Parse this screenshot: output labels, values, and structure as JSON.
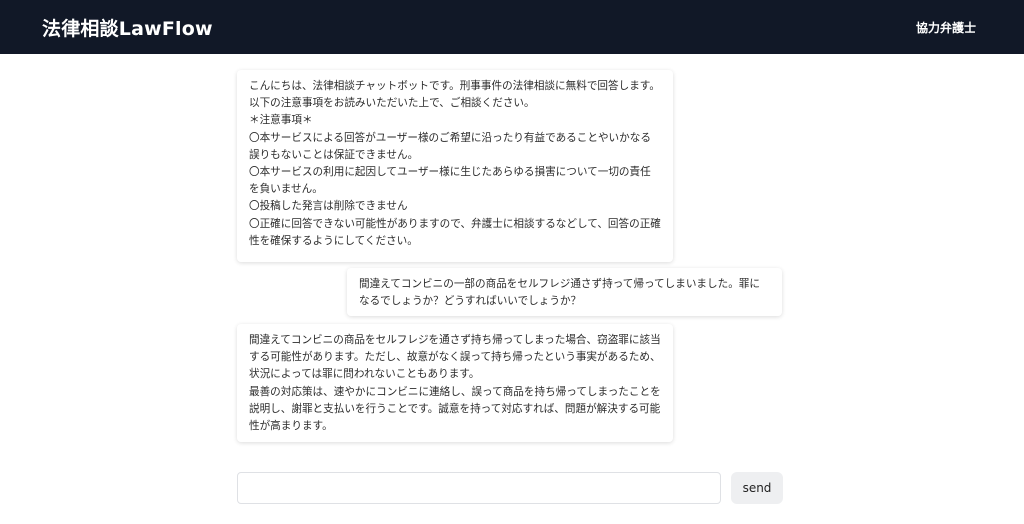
{
  "header": {
    "brand": "法律相談LawFlow",
    "partner_link": "協力弁護士"
  },
  "messages": [
    {
      "role": "bot",
      "text": "こんにちは、法律相談チャットボットです。刑事事件の法律相談に無料で回答します。以下の注意事項をお読みいただいた上で、ご相談ください。\n＊注意事項＊\n〇本サービスによる回答がユーザー様のご希望に沿ったり有益であることやいかなる誤りもないことは保証できません。\n〇本サービスの利用に起因してユーザー様に生じたあらゆる損害について一切の責任を負いません。\n〇投稿した発言は削除できません\n〇正確に回答できない可能性がありますので、弁護士に相談するなどして、回答の正確性を確保するようにしてください。"
    },
    {
      "role": "user",
      "text": "間違えてコンビニの一部の商品をセルフレジ通さず持って帰ってしまいました。罪になるでしょうか？どうすればいいでしょうか？"
    },
    {
      "role": "bot",
      "text": "間違えてコンビニの商品をセルフレジを通さず持ち帰ってしまった場合、窃盗罪に該当する可能性があります。ただし、故意がなく誤って持ち帰ったという事実があるため、状況によっては罪に問われないこともあります。\n最善の対応策は、速やかにコンビニに連絡し、誤って商品を持ち帰ってしまったことを説明し、謝罪と支払いを行うことです。誠意を持って対応すれば、問題が解決する可能性が高まります。"
    }
  ],
  "composer": {
    "placeholder": "",
    "value": "",
    "send_label": "send"
  },
  "colors": {
    "navbar_bg": "#111827",
    "navbar_text": "#ffffff",
    "send_bg": "#eeeff1"
  }
}
